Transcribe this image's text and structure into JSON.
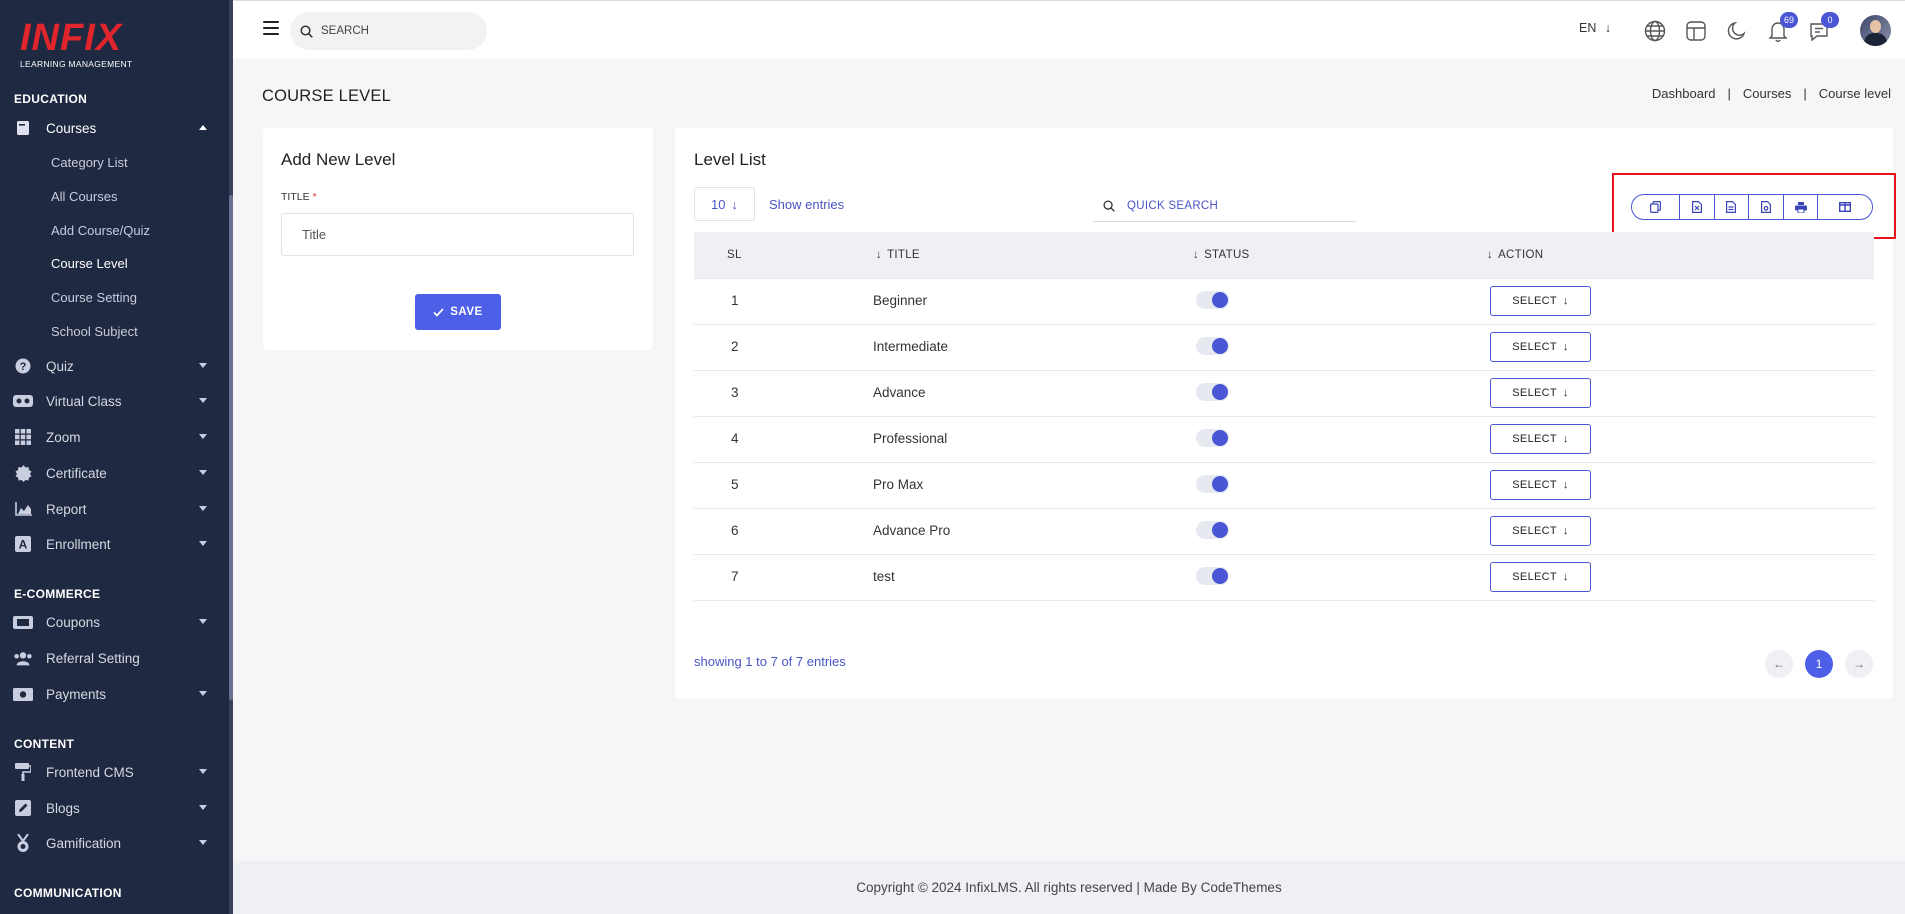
{
  "brand": {
    "logo_text": "INFIX",
    "logo_sub": "LEARNING MANAGEMENT",
    "logo_color": "#e0262c"
  },
  "colors": {
    "sidebar_bg": "#202942",
    "accent": "#4c5fe6",
    "highlight_box": "#e8131b"
  },
  "sidebar": {
    "sections": [
      "EDUCATION",
      "E-COMMERCE",
      "CONTENT",
      "COMMUNICATION"
    ],
    "items": [
      {
        "label": "Courses",
        "icon": "book-icon",
        "expanded": true
      },
      {
        "label": "Quiz",
        "icon": "question-circle-icon"
      },
      {
        "label": "Virtual Class",
        "icon": "vr-headset-icon"
      },
      {
        "label": "Zoom",
        "icon": "grid-icon"
      },
      {
        "label": "Certificate",
        "icon": "badge-certificate-icon"
      },
      {
        "label": "Report",
        "icon": "chart-area-icon"
      },
      {
        "label": "Enrollment",
        "icon": "enrollment-icon"
      },
      {
        "label": "Coupons",
        "icon": "ticket-icon"
      },
      {
        "label": "Referral Setting",
        "icon": "users-icon"
      },
      {
        "label": "Payments",
        "icon": "money-icon"
      },
      {
        "label": "Frontend CMS",
        "icon": "paint-roller-icon"
      },
      {
        "label": "Blogs",
        "icon": "edit-icon"
      },
      {
        "label": "Gamification",
        "icon": "medal-icon"
      }
    ],
    "course_sub_items": [
      "Category List",
      "All Courses",
      "Add Course/Quiz",
      "Course Level",
      "Course Setting",
      "School Subject"
    ],
    "active_sub_item": "Course Level"
  },
  "header": {
    "search_placeholder": "SEARCH",
    "language": "EN",
    "notification_count": "69",
    "message_count": "0"
  },
  "page": {
    "title": "COURSE LEVEL",
    "breadcrumb": [
      "Dashboard",
      "Courses",
      "Course level"
    ],
    "breadcrumb_sep": "|"
  },
  "add_form": {
    "title": "Add New Level",
    "field_label": "TITLE",
    "required_mark": "*",
    "placeholder": "Title",
    "save_label": "SAVE"
  },
  "level_list": {
    "title": "Level List",
    "entries_value": "10",
    "show_entries_label": "Show entries",
    "quick_search_label": "QUICK SEARCH",
    "export_buttons": [
      "copy-icon",
      "csv-icon",
      "excel-icon",
      "pdf-icon",
      "print-icon",
      "columns-icon"
    ],
    "columns": [
      "SL",
      "TITLE",
      "STATUS",
      "ACTION"
    ],
    "select_label": "SELECT",
    "rows": [
      {
        "sl": "1",
        "title": "Beginner",
        "status": true
      },
      {
        "sl": "2",
        "title": "Intermediate",
        "status": true
      },
      {
        "sl": "3",
        "title": "Advance",
        "status": true
      },
      {
        "sl": "4",
        "title": "Professional",
        "status": true
      },
      {
        "sl": "5",
        "title": "Pro Max",
        "status": true
      },
      {
        "sl": "6",
        "title": "Advance Pro",
        "status": true
      },
      {
        "sl": "7",
        "title": "test",
        "status": true
      }
    ],
    "showing_text": "showing 1 to 7 of 7 entries",
    "current_page": "1"
  },
  "footer": {
    "text": "Copyright © 2024 InfixLMS. All rights reserved | Made By CodeThemes"
  }
}
